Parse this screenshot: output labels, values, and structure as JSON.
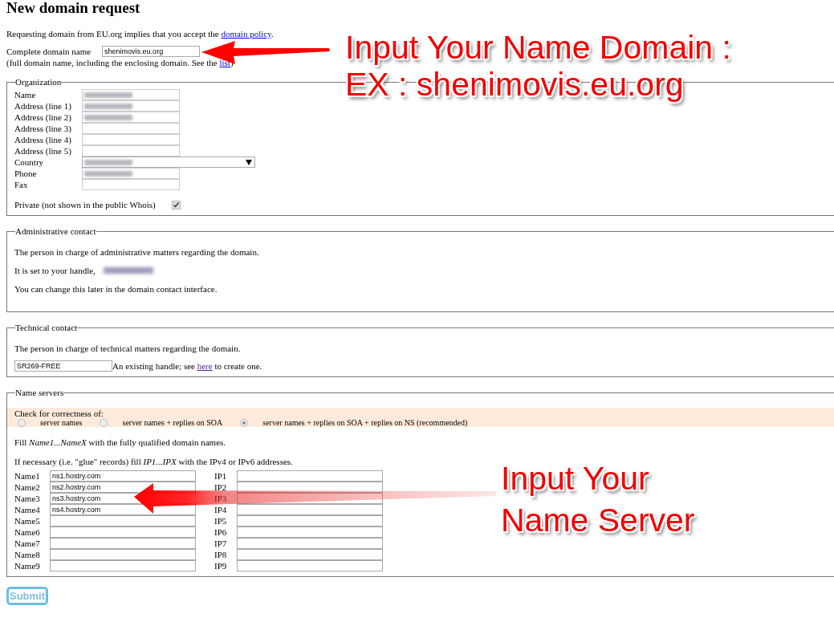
{
  "page": {
    "title": "New domain request"
  },
  "intro": {
    "text": "Requesting domain from EU.org implies that you accept the ",
    "link": "domain policy",
    "end": "."
  },
  "domain_field": {
    "label": "Complete domain name",
    "value": "shenimovis.eu.org",
    "hint": "(full domain name, including the enclosing domain. See the ",
    "hint_link": "list",
    "hint_end": ")"
  },
  "organization": {
    "legend": "Organization",
    "fields": [
      {
        "label": "Name",
        "kind": "text",
        "redacted": true
      },
      {
        "label": "Address (line 1)",
        "kind": "text",
        "redacted": true
      },
      {
        "label": "Address (line 2)",
        "kind": "text",
        "redacted": true
      },
      {
        "label": "Address (line 3)",
        "kind": "text",
        "redacted": false
      },
      {
        "label": "Address (line 4)",
        "kind": "text",
        "redacted": false
      },
      {
        "label": "Address (line 5)",
        "kind": "text",
        "redacted": false
      },
      {
        "label": "Country",
        "kind": "select",
        "redacted": true
      },
      {
        "label": "Phone",
        "kind": "text",
        "redacted": true
      },
      {
        "label": "Fax",
        "kind": "text",
        "redacted": false
      }
    ],
    "private": {
      "label": "Private (not shown in the public Whois)",
      "checked": true
    }
  },
  "admin": {
    "legend": "Administrative contact",
    "description": "The person in charge of administrative matters regarding the domain.",
    "handle_label": "It is set to your handle,",
    "handle_redacted": true,
    "note": "You can change this later in the domain contact interface."
  },
  "technical": {
    "legend": "Technical contact",
    "description": "The person in charge of technical matters regarding the domain.",
    "handle_value": "SR269-FREE",
    "note": "An existing handle; see ",
    "note_link": "here",
    "note_end": " to create one."
  },
  "name_servers": {
    "legend": "Name servers",
    "check_label": "Check for correctness of:",
    "options": [
      {
        "label": "server names",
        "selected": false
      },
      {
        "label": "server names + replies on SOA",
        "selected": false
      },
      {
        "label": "server names + replies on SOA + replies on NS (recommended)",
        "selected": true
      }
    ],
    "fill_note": "Fill *Name1...NameX* with the fully qualified domain names.",
    "glue_note": "If necessary (i.e. \"glue\" records) fill *IP1...IPX* with the IPv4 or IPv6 addresses.",
    "rows": [
      {
        "name_label": "Name1",
        "name_value": "ns1.hostry.com",
        "ip_label": "IP1"
      },
      {
        "name_label": "Name2",
        "name_value": "ns2.hostry.com",
        "ip_label": "IP2"
      },
      {
        "name_label": "Name3",
        "name_value": "ns3.hostry.com",
        "ip_label": "IP3"
      },
      {
        "name_label": "Name4",
        "name_value": "ns4.hostry.com",
        "ip_label": "IP4"
      },
      {
        "name_label": "Name5",
        "ip_label": "IP5"
      },
      {
        "name_label": "Name6",
        "ip_label": "IP6"
      },
      {
        "name_label": "Name7",
        "ip_label": "IP7"
      },
      {
        "name_label": "Name8",
        "ip_label": "IP8"
      },
      {
        "name_label": "Name9",
        "ip_label": "IP9"
      }
    ]
  },
  "submit": {
    "label": "Submit"
  },
  "annotations": [
    {
      "lines": [
        "Input Your Name Domain :",
        "EX : shenimovis.eu.org"
      ]
    },
    {
      "lines": [
        "Input Your",
        "Name Server"
      ]
    }
  ]
}
